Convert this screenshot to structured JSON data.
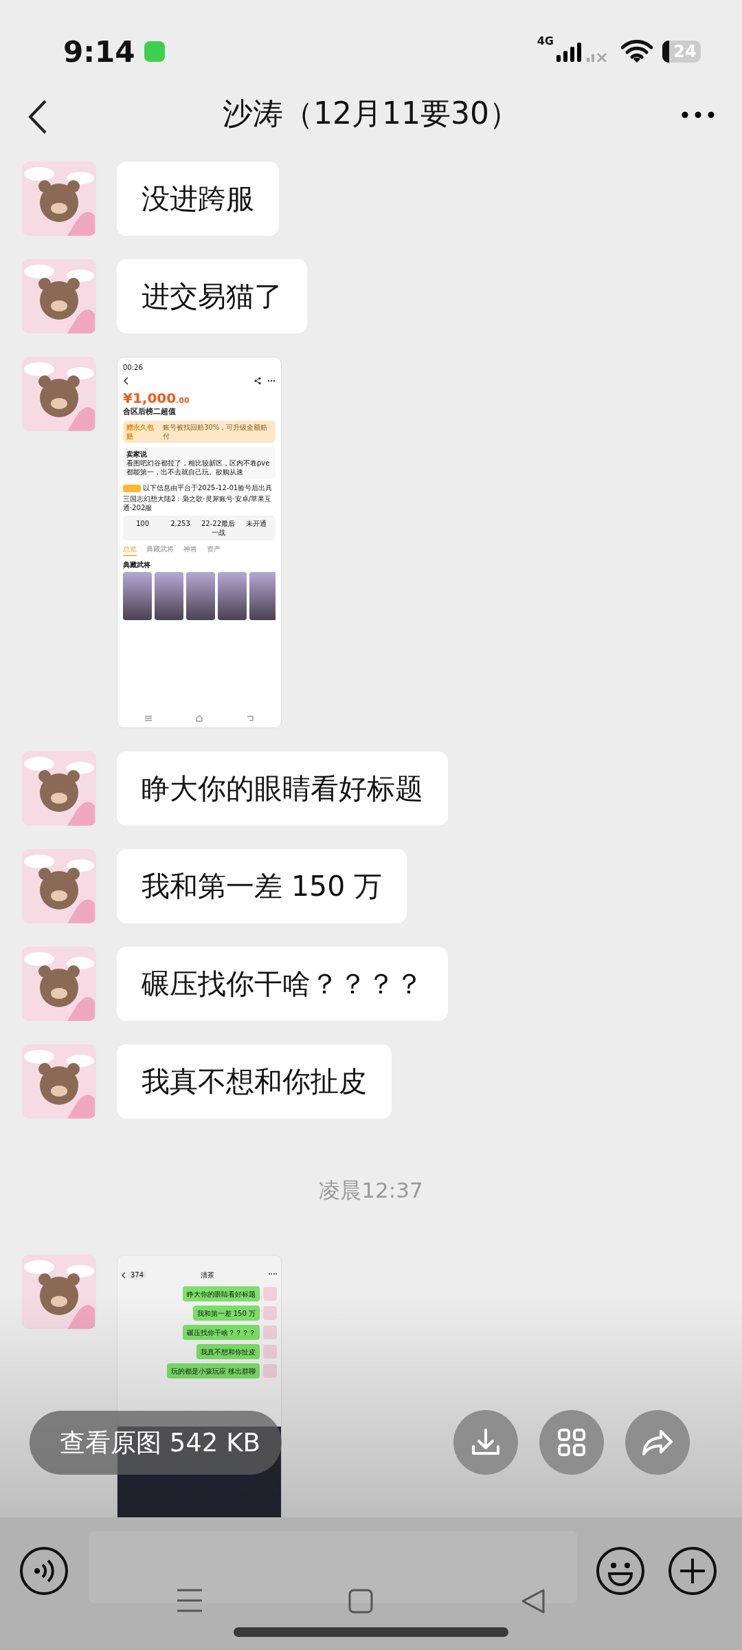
{
  "status_bar": {
    "time": "9:14",
    "network": "4G",
    "battery": "24"
  },
  "header": {
    "title": "沙涛（12月11要30）"
  },
  "messages": [
    {
      "kind": "text",
      "text": "没进跨服"
    },
    {
      "kind": "text",
      "text": "进交易猫了"
    },
    {
      "kind": "image",
      "screen": {
        "kind": "listing",
        "time": "00:26",
        "price": "¥1,000",
        "price_cents": ".00",
        "title": "合区后榜二超值",
        "guarantee_label": "赠永久包赔",
        "guarantee_text": "账号被找回赔30%，可升级全额赔付",
        "seller_label": "卖家说",
        "seller_note": "看图吧幻谷都拉了，相比较新区，区内不卷pve都能第一，出不去就自己玩。欲购从速",
        "report_note": "以下信息由平台于2025-12-01验号后出具",
        "account": "三国志幻想大陆2：枭之歌·灵犀账号·安卓/苹果互通·202服",
        "stats": [
          "100",
          "2,253",
          "22-22最后一战",
          "未开通"
        ],
        "tabs": [
          {
            "label": "总览",
            "selected": true
          },
          {
            "label": "典藏武将",
            "selected": false
          },
          {
            "label": "神将",
            "selected": false
          },
          {
            "label": "资产",
            "selected": false
          }
        ],
        "section": "典藏武将"
      }
    },
    {
      "kind": "text",
      "text": "睁大你的眼睛看好标题"
    },
    {
      "kind": "text",
      "text": "我和第一差 150 万"
    },
    {
      "kind": "text",
      "text": "碾压找你干啥？？？？"
    },
    {
      "kind": "text",
      "text": "我真不想和你扯皮"
    },
    {
      "kind": "time",
      "text": "凌晨12:37"
    },
    {
      "kind": "image",
      "screen": {
        "kind": "chat",
        "back_count": "374",
        "title": "清茶",
        "bubbles": [
          "睁大你的眼睛看好标题",
          "我和第一差 150 万",
          "碾压找你干啥？？？？",
          "我真不想和你扯皮",
          "玩的都是小孩玩应 移出群聊"
        ]
      }
    }
  ],
  "image_viewer": {
    "original_button": "查看原图 542 KB"
  }
}
